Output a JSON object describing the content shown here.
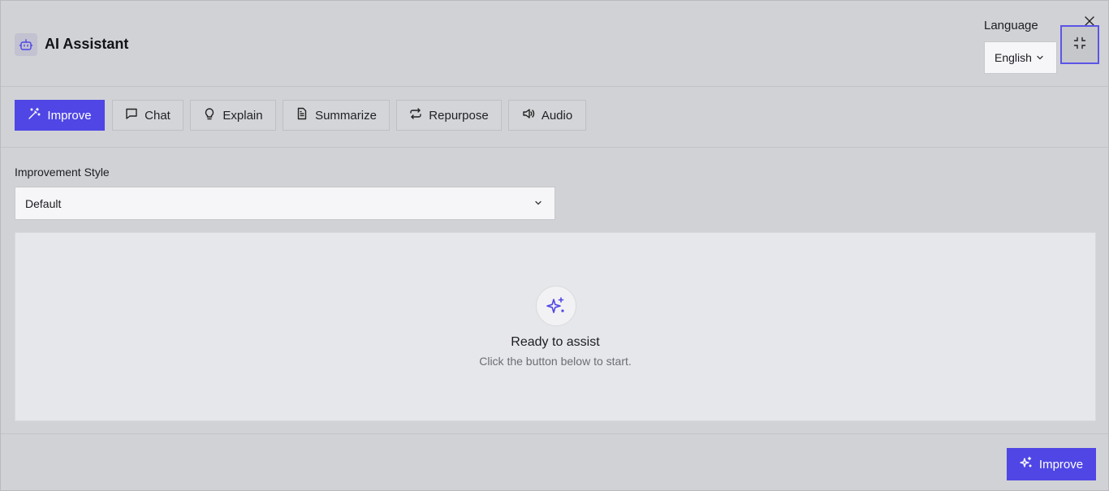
{
  "header": {
    "title": "AI Assistant",
    "title_icon": "bot-icon",
    "language_label": "Language",
    "language_value": "English",
    "close_icon": "close-icon",
    "minimize_icon": "minimize-icon"
  },
  "tabs": [
    {
      "label": "Improve",
      "icon": "magic-wand-icon",
      "active": true
    },
    {
      "label": "Chat",
      "icon": "chat-bubble-icon",
      "active": false
    },
    {
      "label": "Explain",
      "icon": "lightbulb-icon",
      "active": false
    },
    {
      "label": "Summarize",
      "icon": "document-icon",
      "active": false
    },
    {
      "label": "Repurpose",
      "icon": "repeat-icon",
      "active": false
    },
    {
      "label": "Audio",
      "icon": "speaker-icon",
      "active": false
    }
  ],
  "main": {
    "style_label": "Improvement Style",
    "style_value": "Default",
    "empty_state": {
      "icon": "sparkles-icon",
      "title": "Ready to assist",
      "subtitle": "Click the button below to start."
    }
  },
  "footer": {
    "action_label": "Improve",
    "action_icon": "sparkles-icon"
  },
  "colors": {
    "accent": "#4f46e5",
    "focus_ring": "#5b55e6"
  }
}
